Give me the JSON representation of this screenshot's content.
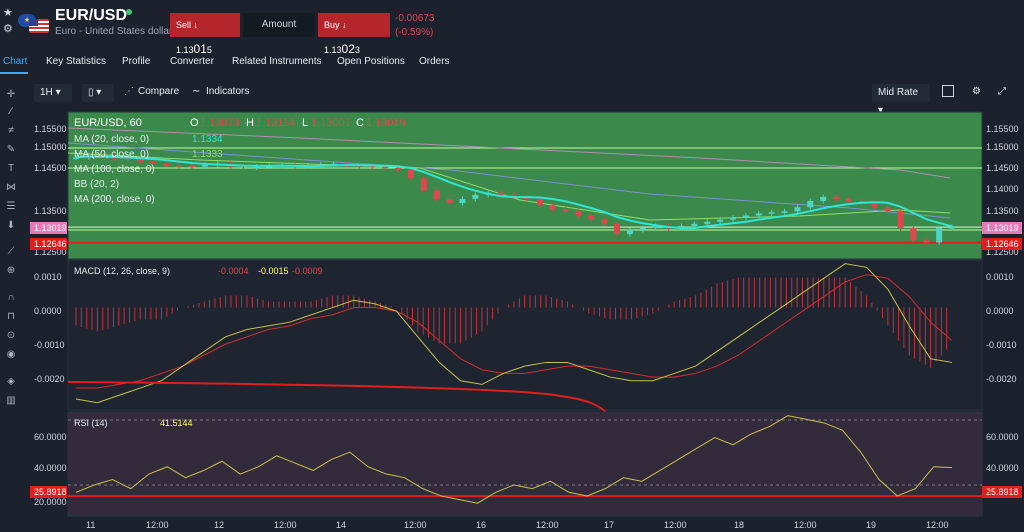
{
  "header": {
    "symbol": "EUR/USD",
    "description": "Euro - United States dollar",
    "sell_label": "Sell",
    "sell_arrow": "↓",
    "sell_price_small": "1.13",
    "sell_price_big": "01",
    "sell_price_tail": "5",
    "amount_label": "Amount",
    "buy_label": "Buy",
    "buy_arrow": "↓",
    "buy_price_small": "1.13",
    "buy_price_big": "02",
    "buy_price_tail": "3",
    "change_abs": "-0.00673",
    "change_pct": "(-0.59%)"
  },
  "tabs": [
    "Chart",
    "Key Statistics",
    "Profile",
    "Converter",
    "Related Instruments",
    "Open Positions",
    "Orders"
  ],
  "toolbar": {
    "interval": "1H",
    "compare": "Compare",
    "indicators": "Indicators",
    "mid_rate": "Mid Rate"
  },
  "legend": {
    "title": "EUR/USD, 60",
    "o_label": "O",
    "o": "1.13073",
    "h_label": "H",
    "h": "1.13114",
    "l_label": "L",
    "l": "1.13001",
    "c_label": "C",
    "c": "1.13019",
    "ma20": "MA (20, close, 0)",
    "ma20_val": "1.1334",
    "ma50": "MA (50, close, 0)",
    "ma50_val": "1.1333",
    "ma100": "MA (100, close, 0)",
    "bb": "BB (20, 2)",
    "ma200": "MA (200, close, 0)",
    "macd": "MACD (12, 26, close, 9)",
    "macd_v1": "-0.0004",
    "macd_v2": "-0.0015",
    "macd_v3": "-0.0009",
    "rsi": "RSI (14)",
    "rsi_val": "41.5144"
  },
  "price_axis": {
    "ticks": [
      "1.15500",
      "1.15000",
      "1.14500",
      "1.14000",
      "1.13500",
      "1.12500"
    ],
    "last_price": "1.13019",
    "support": "1.12646"
  },
  "macd_axis": {
    "ticks": [
      "0.0010",
      "0.0000",
      "-0.0010",
      "-0.0020"
    ]
  },
  "rsi_axis": {
    "ticks": [
      "60.0000",
      "40.0000",
      "20.0000"
    ],
    "level": "25.8918"
  },
  "time_axis": {
    "ticks": [
      "11",
      "12:00",
      "12",
      "12:00",
      "14",
      "12:00",
      "16",
      "12:00",
      "17",
      "12:00",
      "18",
      "12:00",
      "19",
      "12:00"
    ]
  },
  "colors": {
    "background": "#1b222d",
    "price_pane": "#3b8a4c",
    "sell": "#b4262c",
    "accent": "#3fa7f5",
    "up": "#4fd3c4",
    "down": "#e0464e",
    "ma20": "#2ee6d6",
    "rsi_pane": "#3a2f42"
  },
  "chart_data": [
    {
      "type": "candlestick",
      "title": "EUR/USD, 60",
      "ylim": [
        1.1225,
        1.158
      ],
      "ohlc_last": {
        "o": 1.13073,
        "h": 1.13114,
        "l": 1.13001,
        "c": 1.13019
      },
      "close_series": [
        1.147,
        1.1475,
        1.1472,
        1.1468,
        1.1465,
        1.146,
        1.1455,
        1.1452,
        1.145,
        1.1448,
        1.1452,
        1.1455,
        1.145,
        1.1446,
        1.1448,
        1.145,
        1.1452,
        1.1449,
        1.1451,
        1.1453,
        1.1455,
        1.1452,
        1.145,
        1.1448,
        1.1445,
        1.144,
        1.142,
        1.139,
        1.137,
        1.136,
        1.137,
        1.138,
        1.1385,
        1.138,
        1.1375,
        1.137,
        1.1355,
        1.1345,
        1.134,
        1.133,
        1.132,
        1.131,
        1.1285,
        1.1295,
        1.13,
        1.1305,
        1.13,
        1.1305,
        1.131,
        1.1315,
        1.132,
        1.1325,
        1.133,
        1.1335,
        1.1338,
        1.134,
        1.135,
        1.1365,
        1.1375,
        1.137,
        1.1365,
        1.136,
        1.135,
        1.134,
        1.13,
        1.127,
        1.1265,
        1.13,
        1.1302
      ],
      "horizontal_levels": [
        1.13019,
        1.12646
      ]
    },
    {
      "type": "line",
      "title": "MACD (12, 26, close, 9)",
      "ylim": [
        -0.0028,
        0.0013
      ],
      "macd": [
        -0.0025,
        -0.0026,
        -0.0024,
        -0.0022,
        -0.002,
        -0.0016,
        -0.0012,
        -0.0008,
        -0.0006,
        -0.0005,
        -0.0004,
        -0.0002,
        0.0,
        0.0002,
        0.0001,
        -0.0001,
        -0.0008,
        -0.0015,
        -0.002,
        -0.0021,
        -0.0018,
        -0.0016,
        -0.0015,
        -0.0015,
        -0.0017,
        -0.0019,
        -0.002,
        -0.002,
        -0.0018,
        -0.0016,
        -0.0012,
        -0.0008,
        -0.0004,
        0.0,
        0.0004,
        0.0008,
        0.0012,
        0.0011,
        0.0005,
        -0.0005,
        -0.0014,
        -0.0015
      ],
      "signal": [
        -0.0022,
        -0.0022,
        -0.0021,
        -0.002,
        -0.0018,
        -0.0016,
        -0.0013,
        -0.001,
        -0.0008,
        -0.0006,
        -0.0005,
        -0.0003,
        -0.0002,
        0.0,
        0.0,
        -0.0001,
        -0.0004,
        -0.0009,
        -0.0014,
        -0.0017,
        -0.0018,
        -0.0018,
        -0.0017,
        -0.0016,
        -0.0016,
        -0.0017,
        -0.0018,
        -0.0019,
        -0.0019,
        -0.0018,
        -0.0016,
        -0.0013,
        -0.0009,
        -0.0005,
        -0.0001,
        0.0003,
        0.0007,
        0.0009,
        0.0008,
        0.0003,
        -0.0004,
        -0.0009
      ]
    },
    {
      "type": "line",
      "title": "RSI (14)",
      "ylim": [
        15,
        72
      ],
      "values": [
        28,
        32,
        35,
        30,
        38,
        42,
        36,
        40,
        45,
        38,
        42,
        48,
        44,
        40,
        46,
        50,
        42,
        38,
        36,
        30,
        26,
        24,
        22,
        28,
        32,
        30,
        34,
        28,
        26,
        30,
        36,
        34,
        40,
        46,
        52,
        58,
        54,
        60,
        64,
        70,
        68,
        66,
        62,
        50,
        35,
        26,
        30,
        42,
        41.5
      ],
      "level": 25.8918
    }
  ]
}
